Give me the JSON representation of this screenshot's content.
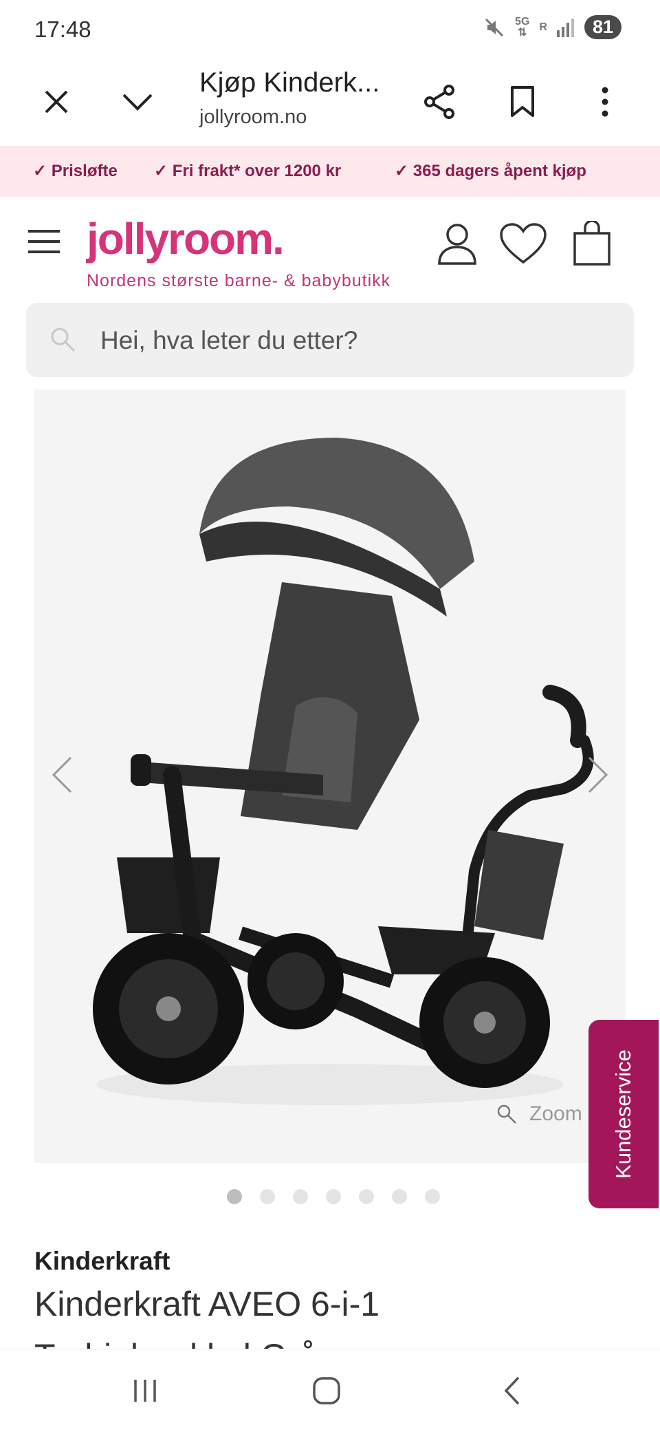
{
  "status": {
    "time": "17:48",
    "net_top": "5G",
    "net_bottom": "R",
    "battery": "81"
  },
  "browser": {
    "title": "Kjøp Kinderk...",
    "url": "jollyroom.no"
  },
  "usp": [
    {
      "label": "Prisløfte"
    },
    {
      "label": "Fri frakt* over 1200 kr"
    },
    {
      "label": "365 dagers åpent kjøp"
    }
  ],
  "header": {
    "logo": "jollyroom.",
    "tagline": "Nordens største barne- & babybutikk"
  },
  "search": {
    "placeholder": "Hei, hva leter du etter?"
  },
  "gallery": {
    "zoom_label": "Zoom",
    "dot_count": 7,
    "active_index": 0
  },
  "kundeservice": {
    "label": "Kundeservice"
  },
  "product": {
    "brand": "Kinderkraft",
    "name_line1": "Kinderkraft AVEO 6-i-1",
    "name_line2": "Trehjulssykkel Grå"
  },
  "colors": {
    "brand_pink": "#d6337a",
    "brand_dark": "#a3175a",
    "usp_bg": "#fde8ec"
  }
}
